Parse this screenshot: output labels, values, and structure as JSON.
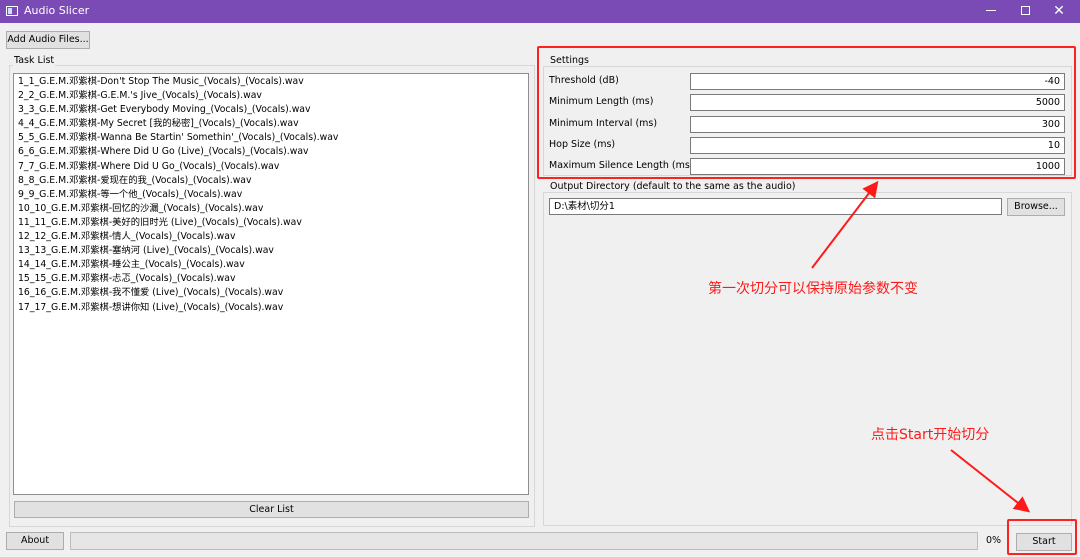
{
  "window": {
    "title": "Audio Slicer"
  },
  "toolbar": {
    "add_files": "Add Audio Files..."
  },
  "task_list": {
    "label": "Task List",
    "items": [
      "1_1_G.E.M.邓紫棋-Don't Stop The Music_(Vocals)_(Vocals).wav",
      "2_2_G.E.M.邓紫棋-G.E.M.'s Jive_(Vocals)_(Vocals).wav",
      "3_3_G.E.M.邓紫棋-Get Everybody Moving_(Vocals)_(Vocals).wav",
      "4_4_G.E.M.邓紫棋-My Secret [我的秘密]_(Vocals)_(Vocals).wav",
      "5_5_G.E.M.邓紫棋-Wanna Be Startin' Somethin'_(Vocals)_(Vocals).wav",
      "6_6_G.E.M.邓紫棋-Where Did U Go (Live)_(Vocals)_(Vocals).wav",
      "7_7_G.E.M.邓紫棋-Where Did U Go_(Vocals)_(Vocals).wav",
      "8_8_G.E.M.邓紫棋-爱现在的我_(Vocals)_(Vocals).wav",
      "9_9_G.E.M.邓紫棋-等一个他_(Vocals)_(Vocals).wav",
      "10_10_G.E.M.邓紫棋-回忆的沙漏_(Vocals)_(Vocals).wav",
      "11_11_G.E.M.邓紫棋-美好的旧时光 (Live)_(Vocals)_(Vocals).wav",
      "12_12_G.E.M.邓紫棋-情人_(Vocals)_(Vocals).wav",
      "13_13_G.E.M.邓紫棋-塞纳河 (Live)_(Vocals)_(Vocals).wav",
      "14_14_G.E.M.邓紫棋-睡公主_(Vocals)_(Vocals).wav",
      "15_15_G.E.M.邓紫棋-忐忑_(Vocals)_(Vocals).wav",
      "16_16_G.E.M.邓紫棋-我不懂爱 (Live)_(Vocals)_(Vocals).wav",
      "17_17_G.E.M.邓紫棋-想讲你知 (Live)_(Vocals)_(Vocals).wav"
    ],
    "clear_button": "Clear List"
  },
  "settings": {
    "label": "Settings",
    "threshold": {
      "label": "Threshold (dB)",
      "value": "-40"
    },
    "min_length": {
      "label": "Minimum Length (ms)",
      "value": "5000"
    },
    "min_interval": {
      "label": "Minimum Interval (ms)",
      "value": "300"
    },
    "hop_size": {
      "label": "Hop Size (ms)",
      "value": "10"
    },
    "max_silence": {
      "label": "Maximum Silence Length (ms)",
      "value": "1000"
    }
  },
  "output": {
    "label": "Output Directory (default to the same as the audio)",
    "value": "D:\\素材\\切分1",
    "browse_button": "Browse..."
  },
  "footer": {
    "about_button": "About",
    "progress_text": "0%",
    "progress_value": 0,
    "start_button": "Start"
  },
  "annotations": {
    "settings_note": "第一次切分可以保持原始参数不变",
    "start_note": "点击Start开始切分"
  },
  "colors": {
    "titlebar": "#7b4bb5",
    "annotation": "#ff1a1a",
    "progress_fill": "#06b025"
  }
}
